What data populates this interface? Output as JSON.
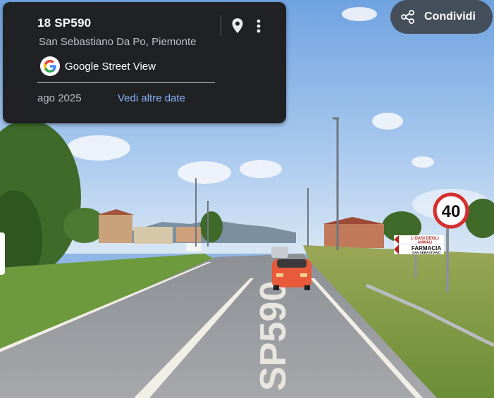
{
  "location": {
    "title": "18 SP590",
    "subtitle": "San Sebastiano Da Po, Piemonte",
    "pin_icon": "location-pin-icon",
    "more_icon": "more-vertical-icon"
  },
  "street_view": {
    "label": "Google Street View",
    "logo_icon": "google-g-logo-icon"
  },
  "dates": {
    "current": "ago 2025",
    "more_link": "Vedi altre date"
  },
  "share": {
    "label": "Condividi",
    "icon": "share-icon"
  },
  "scene": {
    "road_marking": "SP590",
    "speed_limit": "40",
    "sign_top": "L'OASI DEGLI",
    "sign_top2": "ANIMALI",
    "sign_mid": "FARMACIA",
    "sign_bottom": "SAN SEBASTIANO"
  },
  "colors": {
    "card_bg": "#202124",
    "link": "#8ab4f8",
    "sky": "#8fb6e6",
    "grass": "#6c9a3c"
  }
}
